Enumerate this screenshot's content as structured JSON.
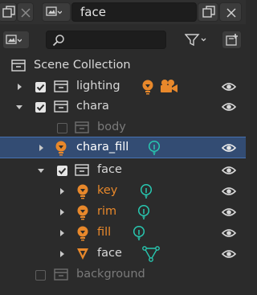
{
  "header": {
    "editor_type_icon": "image-editor-icon",
    "search_value": "face"
  },
  "filterbar": {
    "display_mode_icon": "image-editor-icon",
    "search_placeholder": "",
    "filter_icon": "funnel-icon",
    "new_collection_icon": "new-collection-icon"
  },
  "tree": {
    "scene_collection": "Scene Collection",
    "lighting": "lighting",
    "chara": "chara",
    "body": "body",
    "chara_fill": "chara_fill",
    "face_collection": "face",
    "key": "key",
    "rim": "rim",
    "fill": "fill",
    "face_mesh": "face",
    "background": "background"
  },
  "colors": {
    "selected_row": "#334c73",
    "light_orange": "#e8882b",
    "light_data_teal": "#28c7b0",
    "mesh_data_teal": "#28c7b0",
    "dimmed_text": "#7a7a7a"
  }
}
